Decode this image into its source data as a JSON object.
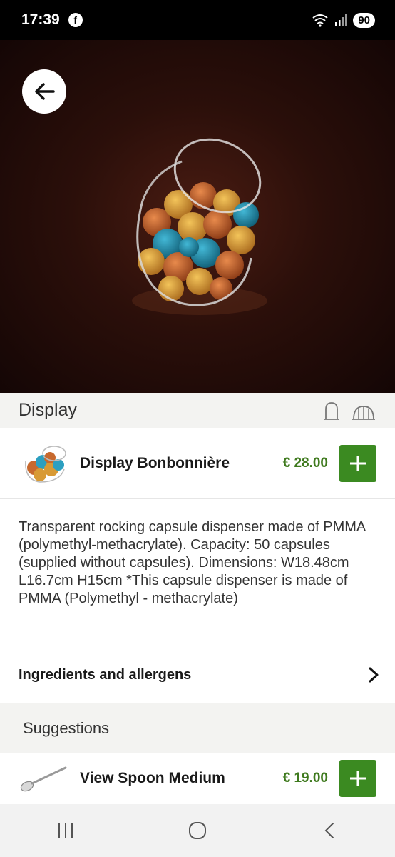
{
  "status": {
    "time": "17:39",
    "fb": "f",
    "battery": "90"
  },
  "hero": {
    "back_label": "back"
  },
  "section": {
    "title": "Display"
  },
  "product": {
    "name": "Display Bonbonnière",
    "price": "€ 28.00",
    "add_label": "+"
  },
  "description": "Transparent rocking capsule dispenser made of PMMA (polymethyl-methacrylate). Capacity: 50 capsules (supplied without capsules). Dimensions: W18.48cm L16.7cm H15cm *This capsule dispenser is made of PMMA (Polymethyl - methacrylate)",
  "ingredients": {
    "label": "Ingredients and allergens"
  },
  "suggestions": {
    "title": "Suggestions",
    "items": [
      {
        "name": "View Spoon Medium",
        "price": "€ 19.00"
      }
    ]
  },
  "colors": {
    "accent": "#3b8a21",
    "price": "#3f7a1e",
    "hero_bg": "#2b0f0a"
  }
}
